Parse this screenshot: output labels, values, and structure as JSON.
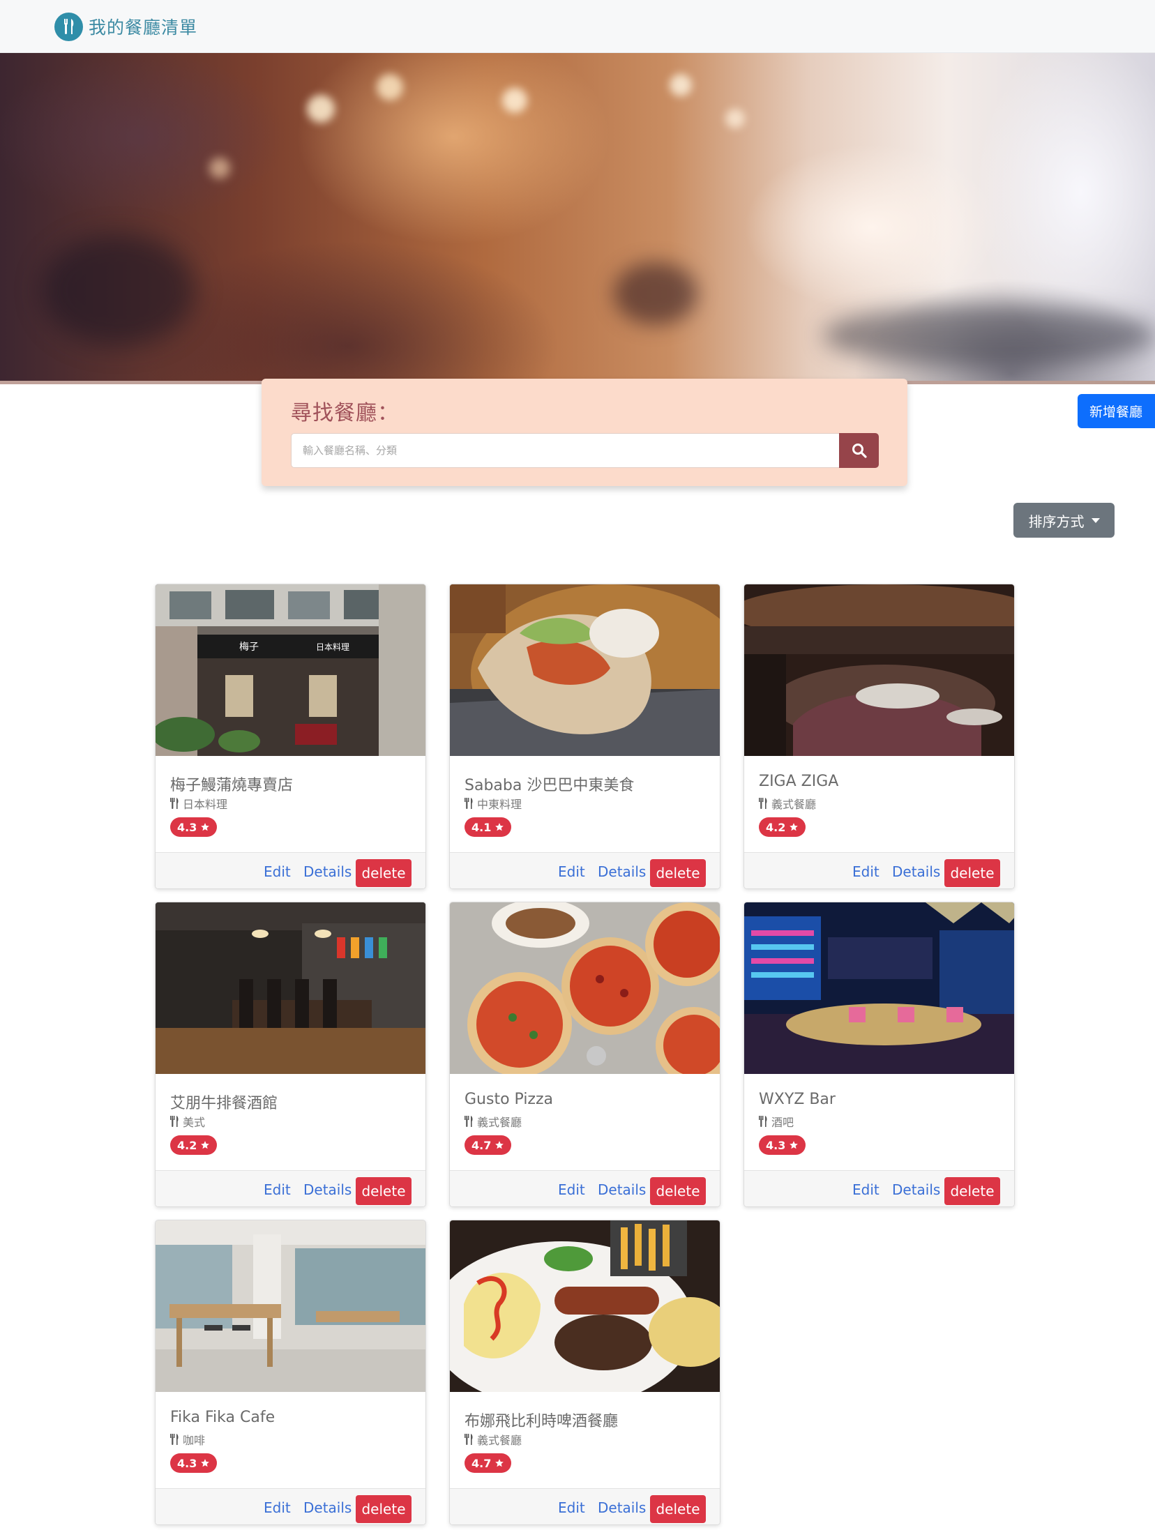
{
  "navbar": {
    "brand": "我的餐廳清單",
    "logo_icon": "fork-knife-icon"
  },
  "search": {
    "title": "尋找餐廳：",
    "placeholder": "輸入餐廳名稱、分類",
    "button_icon": "search-icon"
  },
  "add_button": "新增餐廳",
  "sort_button": "排序方式",
  "card_actions": {
    "edit": "Edit",
    "details": "Details",
    "delete": "delete"
  },
  "restaurants": [
    {
      "name": "梅子鰻蒲燒專賣店",
      "category": "日本料理",
      "rating": "4.3"
    },
    {
      "name": "Sababa 沙巴巴中東美食",
      "category": "中東料理",
      "rating": "4.1"
    },
    {
      "name": "ZIGA ZIGA",
      "category": "義式餐廳",
      "rating": "4.2"
    },
    {
      "name": "艾朋牛排餐酒館",
      "category": "美式",
      "rating": "4.2"
    },
    {
      "name": "Gusto Pizza",
      "category": "義式餐廳",
      "rating": "4.7"
    },
    {
      "name": "WXYZ Bar",
      "category": "酒吧",
      "rating": "4.3"
    },
    {
      "name": "Fika Fika Cafe",
      "category": "咖啡",
      "rating": "4.3"
    },
    {
      "name": "布娜飛比利時啤酒餐廳",
      "category": "義式餐廳",
      "rating": "4.7"
    }
  ],
  "colors": {
    "primary": "#0d6efd",
    "danger": "#dc3545",
    "secondary": "#6c757d",
    "brand": "#2f8ea9",
    "search_panel": "#fcdbcb",
    "search_button": "#96444a"
  }
}
